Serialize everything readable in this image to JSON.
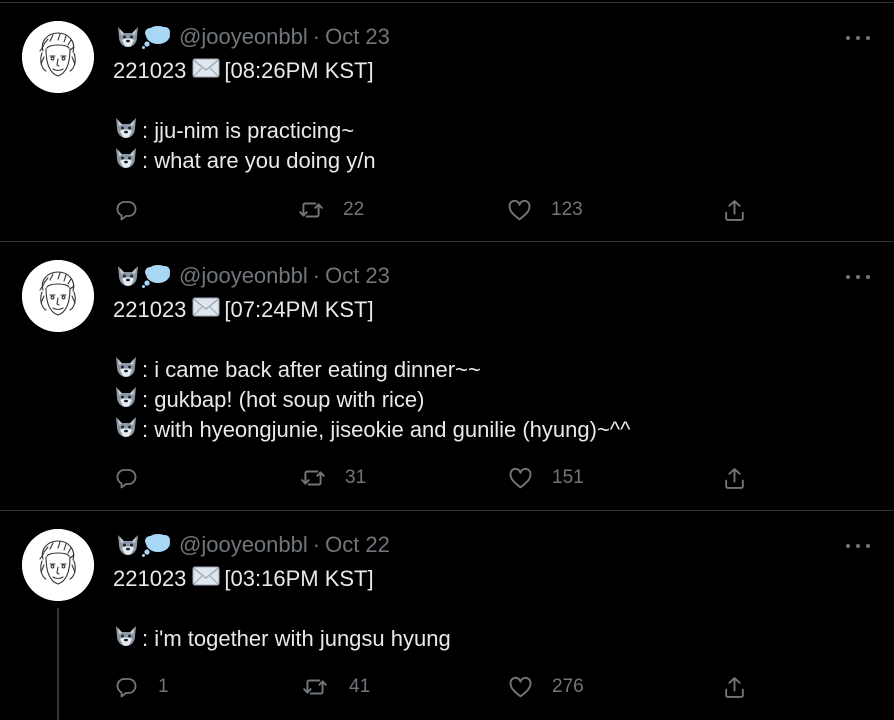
{
  "colors": {
    "background": "#000000",
    "primary_text": "#e7e9ea",
    "secondary_text": "#71767b",
    "divider": "#2f3336"
  },
  "tweets": [
    {
      "handle": "@jooyeonbbl",
      "separator": "·",
      "date": "Oct 23",
      "header_emojis": [
        "wolf-emoji",
        "thought-balloon-emoji"
      ],
      "title_date": "221023",
      "title_time": "[08:26PM KST]",
      "lines": [
        ": jju-nim is practicing~",
        ": what are you doing y/n"
      ],
      "reply_count": "",
      "retweet_count": "22",
      "like_count": "123"
    },
    {
      "handle": "@jooyeonbbl",
      "separator": "·",
      "date": "Oct 23",
      "header_emojis": [
        "wolf-emoji",
        "thought-balloon-emoji"
      ],
      "title_date": "221023",
      "title_time": "[07:24PM KST]",
      "lines": [
        ": i came back after eating dinner~~",
        ": gukbap! (hot soup with rice)",
        ": with hyeongjunie, jiseokie and gunilie (hyung)~^^"
      ],
      "reply_count": "",
      "retweet_count": "31",
      "like_count": "151"
    },
    {
      "handle": "@jooyeonbbl",
      "separator": "·",
      "date": "Oct 22",
      "header_emojis": [
        "wolf-emoji",
        "thought-balloon-emoji"
      ],
      "title_date": "221023",
      "title_time": "[03:16PM KST]",
      "lines": [
        ": i'm together with jungsu hyung"
      ],
      "reply_count": "1",
      "retweet_count": "41",
      "like_count": "276"
    }
  ]
}
